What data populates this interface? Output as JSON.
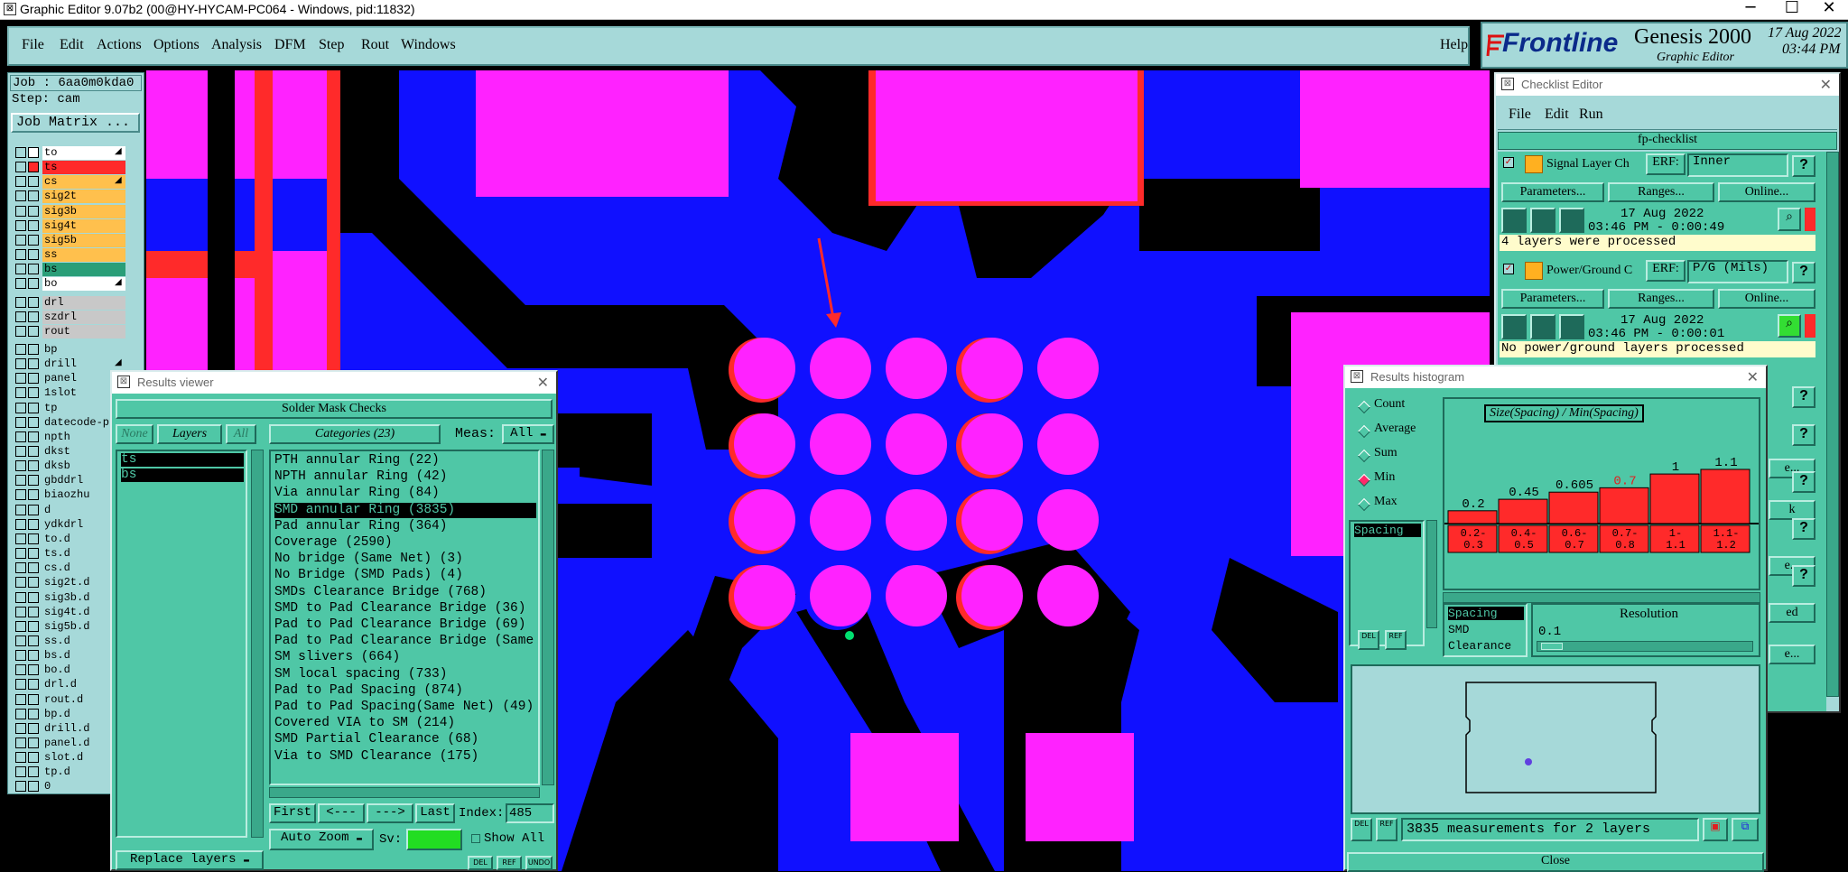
{
  "window": {
    "title": "Graphic Editor 9.07b2 (00@HY-HYCAM-PC064 - Windows, pid:11832)",
    "minimize": "─",
    "maximize": "☐",
    "close": "✕"
  },
  "menu": {
    "items": [
      "File",
      "Edit",
      "Actions",
      "Options",
      "Analysis",
      "DFM",
      "Step",
      "Rout",
      "Windows"
    ],
    "help": "Help"
  },
  "brand": {
    "logo": "Frontline",
    "product": "Genesis 2000",
    "subtitle": "Graphic Editor",
    "date": "17 Aug 2022",
    "time": "03:44 PM"
  },
  "job": {
    "job_label": "Job : 6aa0m0kda0",
    "step_label": "Step: cam",
    "matrix_button": "Job Matrix ..."
  },
  "layers": [
    {
      "name": "to",
      "color": "#ffffff",
      "arrow": true
    },
    {
      "name": "ts",
      "color": "#ff2a2a"
    },
    {
      "name": "cs",
      "color": "#ffc04d",
      "arrow": true
    },
    {
      "name": "sig2t",
      "color": "#ffc04d"
    },
    {
      "name": "sig3b",
      "color": "#ffc04d"
    },
    {
      "name": "sig4t",
      "color": "#ffc04d"
    },
    {
      "name": "sig5b",
      "color": "#ffc04d"
    },
    {
      "name": "ss",
      "color": "#ffc04d"
    },
    {
      "name": "bs",
      "color": "#2a9e78"
    },
    {
      "name": "bo",
      "color": "#ffffff",
      "arrow": true
    },
    {
      "name": "drl",
      "color": "#c8c8c8"
    },
    {
      "name": "szdrl",
      "color": "#c8c8c8"
    },
    {
      "name": "rout",
      "color": "#c8c8c8"
    },
    {
      "name": "bp",
      "color": "#a6d9d9"
    },
    {
      "name": "drill",
      "color": "#a6d9d9",
      "arrow": true
    },
    {
      "name": "panel",
      "color": "#a6d9d9",
      "arrow": true
    },
    {
      "name": "1slot",
      "color": "#a6d9d9"
    },
    {
      "name": "tp",
      "color": "#a6d9d9"
    },
    {
      "name": "datecode-pl",
      "color": "#a6d9d9"
    },
    {
      "name": "npth",
      "color": "#a6d9d9"
    },
    {
      "name": "dkst",
      "color": "#a6d9d9"
    },
    {
      "name": "dksb",
      "color": "#a6d9d9"
    },
    {
      "name": "gbddrl",
      "color": "#a6d9d9"
    },
    {
      "name": "biaozhu",
      "color": "#a6d9d9"
    },
    {
      "name": "d",
      "color": "#a6d9d9"
    },
    {
      "name": "ydkdrl",
      "color": "#a6d9d9"
    },
    {
      "name": "to.d",
      "color": "#a6d9d9",
      "arrow": true
    },
    {
      "name": "ts.d",
      "color": "#a6d9d9"
    },
    {
      "name": "cs.d",
      "color": "#a6d9d9"
    },
    {
      "name": "sig2t.d",
      "color": "#a6d9d9"
    },
    {
      "name": "sig3b.d",
      "color": "#a6d9d9"
    },
    {
      "name": "sig4t.d",
      "color": "#a6d9d9"
    },
    {
      "name": "sig5b.d",
      "color": "#a6d9d9"
    },
    {
      "name": "ss.d",
      "color": "#a6d9d9"
    },
    {
      "name": "bs.d",
      "color": "#a6d9d9"
    },
    {
      "name": "bo.d",
      "color": "#a6d9d9",
      "arrow": true
    },
    {
      "name": "drl.d",
      "color": "#a6d9d9"
    },
    {
      "name": "rout.d",
      "color": "#a6d9d9"
    },
    {
      "name": "bp.d",
      "color": "#a6d9d9"
    },
    {
      "name": "drill.d",
      "color": "#a6d9d9",
      "arrow": true
    },
    {
      "name": "panel.d",
      "color": "#a6d9d9",
      "arrow": true
    },
    {
      "name": "slot.d",
      "color": "#a6d9d9"
    },
    {
      "name": "tp.d",
      "color": "#a6d9d9"
    },
    {
      "name": "0",
      "color": "#a6d9d9"
    }
  ],
  "results_viewer": {
    "title": "Results viewer",
    "header": "Solder Mask Checks",
    "none_btn": "None",
    "layers_btn": "Layers",
    "all_btn": "All",
    "layer_list": [
      "ts",
      "bs"
    ],
    "categories_btn": "Categories (23)",
    "meas_label": "Meas:",
    "meas_value": "All",
    "categories": [
      "PTH annular Ring (22)",
      "NPTH annular Ring (42)",
      "Via annular Ring (84)",
      "SMD annular Ring (3835)",
      "Pad annular Ring (364)",
      "Coverage (2590)",
      "No bridge (Same Net) (3)",
      "No Bridge (SMD Pads) (4)",
      "SMDs Clearance Bridge (768)",
      "SMD to Pad Clearance Bridge (36)",
      "Pad to Pad Clearance Bridge (69)",
      "Pad to Pad Clearance Bridge (Same",
      "SM slivers (664)",
      "SM local spacing (733)",
      "Pad to Pad Spacing (874)",
      "Pad to Pad Spacing(Same Net) (49)",
      "Covered VIA to SM (214)",
      "SMD Partial Clearance (68)",
      "Via to SMD Clearance (175)"
    ],
    "selected_index": 3,
    "first_btn": "First",
    "prev_btn": "<---",
    "next_btn": "--->",
    "last_btn": "Last",
    "index_label": "Index:",
    "index_value": "485",
    "autozoom_btn": "Auto Zoom",
    "sv_label": "Sv:",
    "show_all_label": "Show All",
    "replace_layers": "Replace layers",
    "del_btn": "DEL",
    "ref_btn": "REF",
    "undo_btn": "UNDO"
  },
  "checklist": {
    "title": "Checklist Editor",
    "menu": [
      "File",
      "Edit",
      "Run"
    ],
    "name": "fp-checklist",
    "erf_label": "ERF:",
    "help_glyph": "?",
    "items": [
      {
        "name": "Signal Layer Ch",
        "erf": "Inner",
        "params": "Parameters...",
        "ranges": "Ranges...",
        "online": "Online...",
        "date": "17 Aug 2022",
        "time": "03:46 PM - 0:00:49",
        "status": "4 layers were processed",
        "status_color": "#ff2a2a"
      },
      {
        "name": "Power/Ground C",
        "erf": "P/G (Mils)",
        "params": "Parameters...",
        "ranges": "Ranges...",
        "online": "Online...",
        "date": "17 Aug 2022",
        "time": "03:46 PM - 0:00:01",
        "status": "No power/ground layers processed",
        "status_color": "#ff2a2a"
      }
    ],
    "hidden_rows": [
      "e...",
      "k",
      "e...",
      "ed",
      "e..."
    ]
  },
  "histogram": {
    "title": "Results histogram",
    "modes": [
      "Count",
      "Average",
      "Sum",
      "Min",
      "Max"
    ],
    "selected_mode": "Min",
    "attr_list": [
      "Spacing"
    ],
    "chart_title": "Size(Spacing) / Min(Spacing)",
    "sort_list": [
      "Spacing",
      "SMD",
      "Clearance"
    ],
    "resolution_label": "Resolution",
    "resolution_value": "0.1",
    "footer": "3835 measurements for 2 layers",
    "del_btn": "DEL",
    "ref_btn": "REF",
    "close_btn": "Close"
  },
  "chart_data": {
    "type": "bar",
    "title": "Size(Spacing) / Min(Spacing)",
    "categories": [
      "0.2-0.3",
      "0.4-0.5",
      "0.6-0.7",
      "0.7-0.8",
      "1-1.1",
      "1.1-1.2"
    ],
    "bin_labels": [
      [
        "0.2-",
        "0.3"
      ],
      [
        "0.4-",
        "0.5"
      ],
      [
        "0.6-",
        "0.7"
      ],
      [
        "0.7-",
        "0.8"
      ],
      [
        "1-",
        "1.1"
      ],
      [
        "1.1-",
        "1.2"
      ]
    ],
    "values": [
      0.2,
      0.45,
      0.605,
      0.7,
      1,
      1.1
    ],
    "value_labels": [
      "0.2",
      "0.45",
      "0.605",
      "0.7",
      "1",
      "1.1"
    ],
    "highlight_index": 3,
    "bar_color": "#ff2a2a",
    "ylim": [
      0,
      1.1
    ]
  },
  "colors": {
    "copper": "#1010ff",
    "mask": "#ff2a2a",
    "pad": "#ff22ff",
    "panel": "#4fc7a6",
    "chrome": "#a6d9d9"
  }
}
